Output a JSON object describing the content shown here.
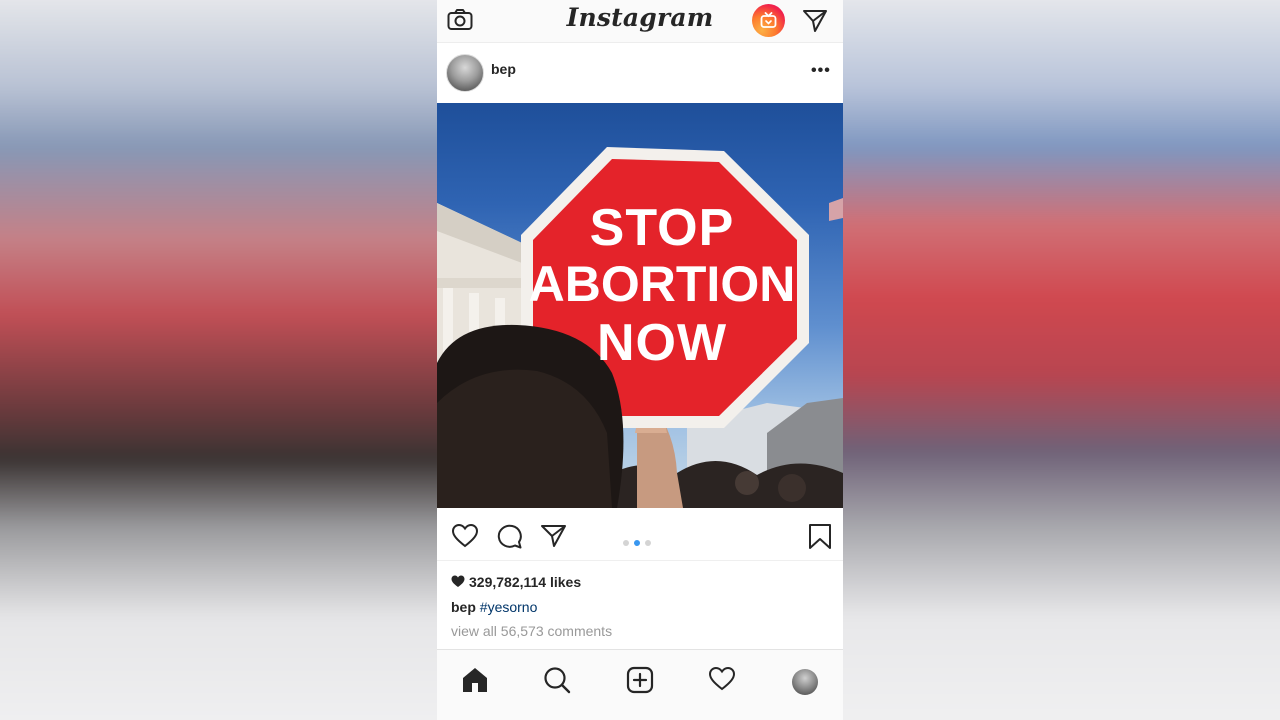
{
  "app": {
    "name": "Instagram"
  },
  "post": {
    "username": "bep",
    "more_label": "•••",
    "image": {
      "sign_lines": [
        "STOP",
        "ABORTION",
        "NOW"
      ]
    },
    "carousel": {
      "count": 3,
      "active_index": 1
    },
    "likes_text": "329,782,114 likes",
    "caption_user": "bep",
    "caption_hashtag": "#yesorno",
    "comments_text": "view all 56,573 comments"
  },
  "icons": {
    "top": [
      "camera-icon",
      "igtv-icon",
      "direct-message-icon"
    ],
    "actions": [
      "like-heart-icon",
      "comment-icon",
      "share-icon",
      "bookmark-icon"
    ],
    "bottom_nav": [
      "home-icon",
      "search-icon",
      "new-post-icon",
      "activity-heart-icon",
      "profile-avatar"
    ]
  },
  "colors": {
    "igtv_gradient": [
      "#fcb045",
      "#f1224a",
      "#e8196a"
    ],
    "sign_red": "#e4232a",
    "hashtag": "#003569",
    "carousel_active": "#3897f0"
  }
}
